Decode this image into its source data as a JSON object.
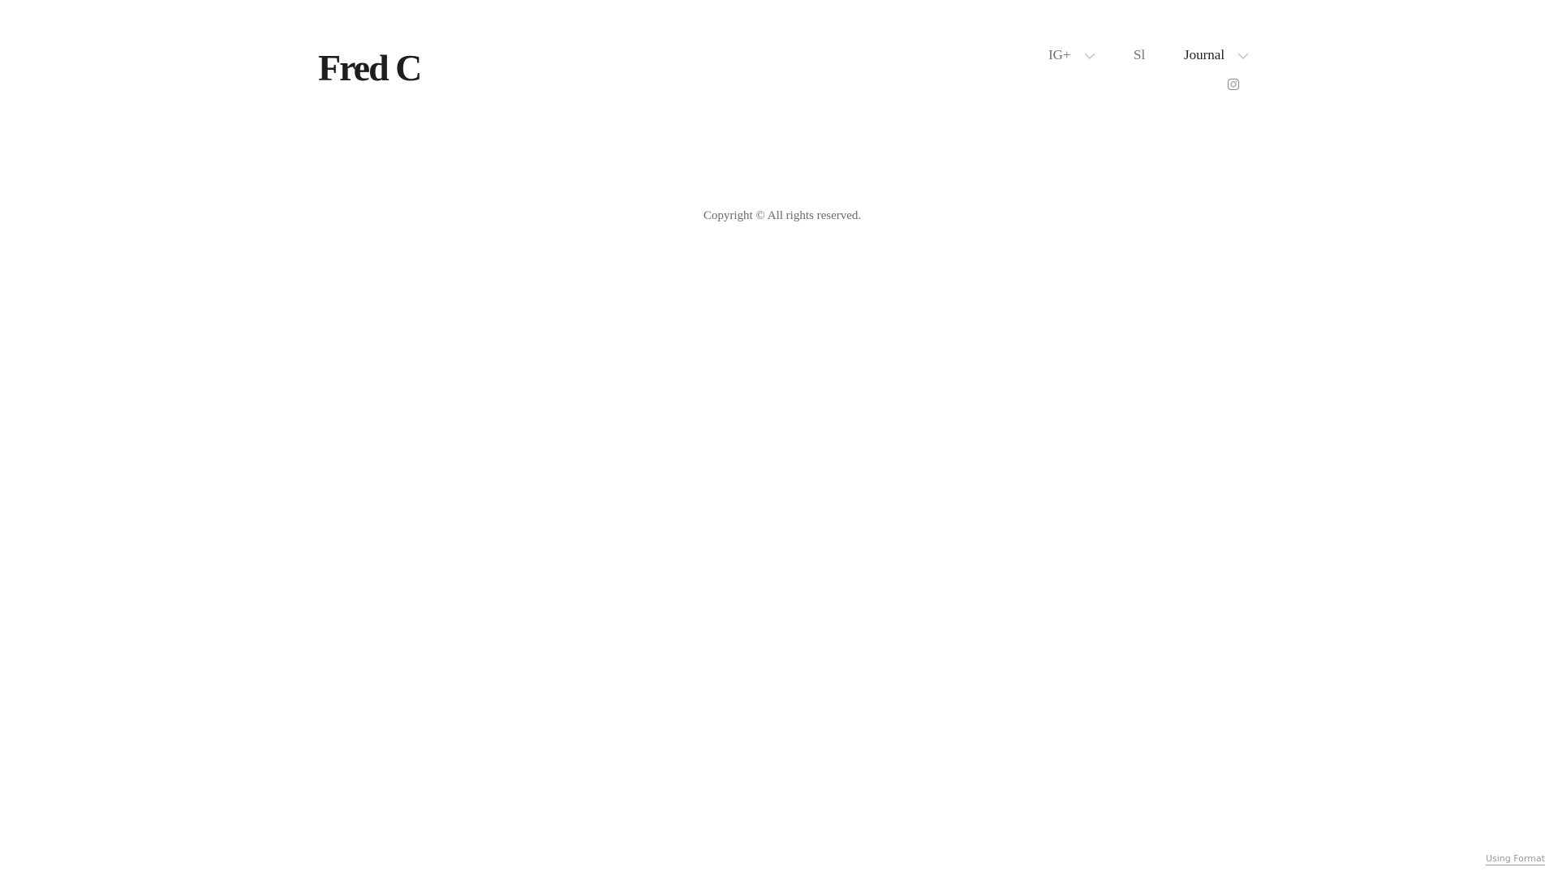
{
  "site": {
    "title": "Fred C"
  },
  "nav": {
    "items": [
      {
        "label": "IG+",
        "has_dropdown": true,
        "active": false
      },
      {
        "label": "Sl",
        "has_dropdown": false,
        "active": false
      },
      {
        "label": "Journal",
        "has_dropdown": true,
        "active": true
      }
    ],
    "social_icon": "instagram-icon"
  },
  "footer": {
    "copyright": "Copyright © All rights reserved.",
    "badge": "Using Format"
  },
  "colors": {
    "background": "#ffffff",
    "title": "#1e1e1e",
    "nav_text": "#6f6f6f",
    "nav_active": "#222222",
    "muted": "#9a9a9a"
  }
}
